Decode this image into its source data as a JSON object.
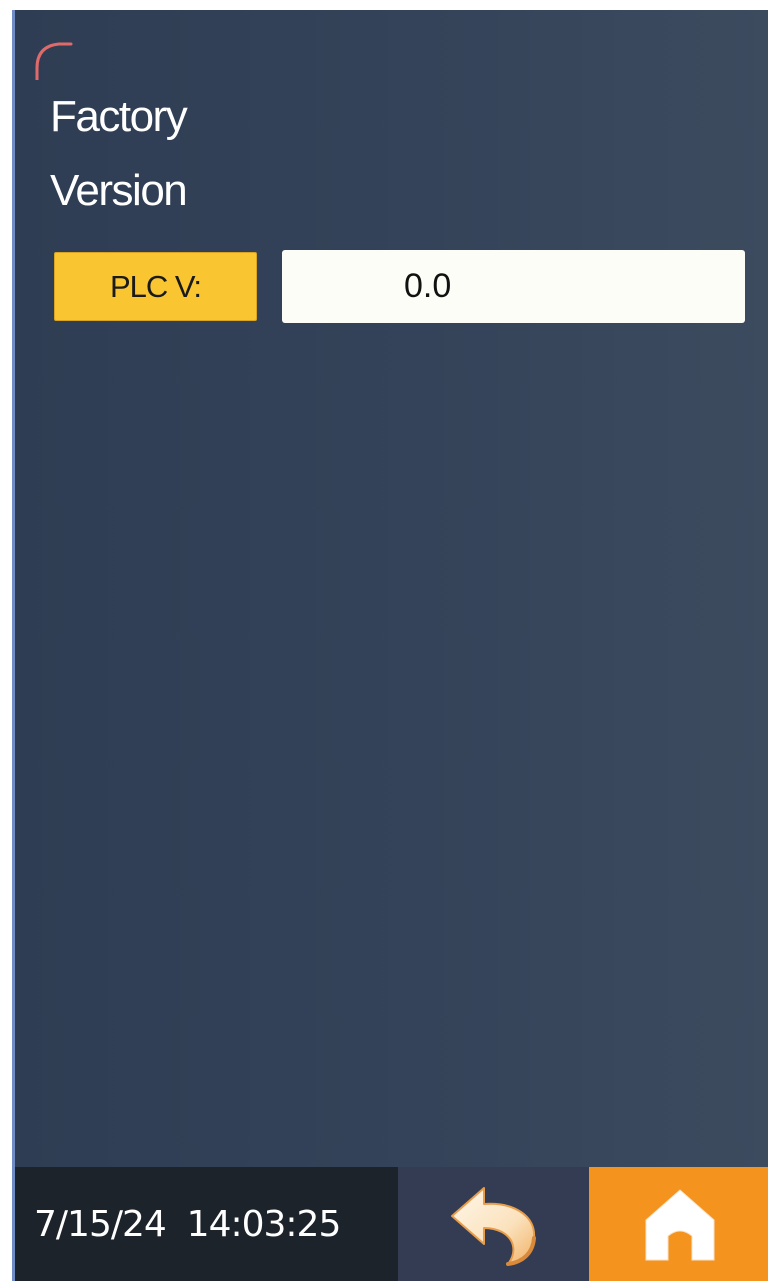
{
  "screen": {
    "title_line1": "Factory",
    "title_line2": "Version"
  },
  "plc": {
    "label": "PLC V:",
    "value": "0.0"
  },
  "footer": {
    "datetime": "7/15/24  14:03:25",
    "back_icon": "back-arrow-icon",
    "home_icon": "home-icon"
  },
  "colors": {
    "background": "#35435a",
    "label_bg": "#f9c530",
    "home_bg": "#f5931f",
    "back_bg": "#333c52",
    "datetime_bg": "#1d232b"
  }
}
